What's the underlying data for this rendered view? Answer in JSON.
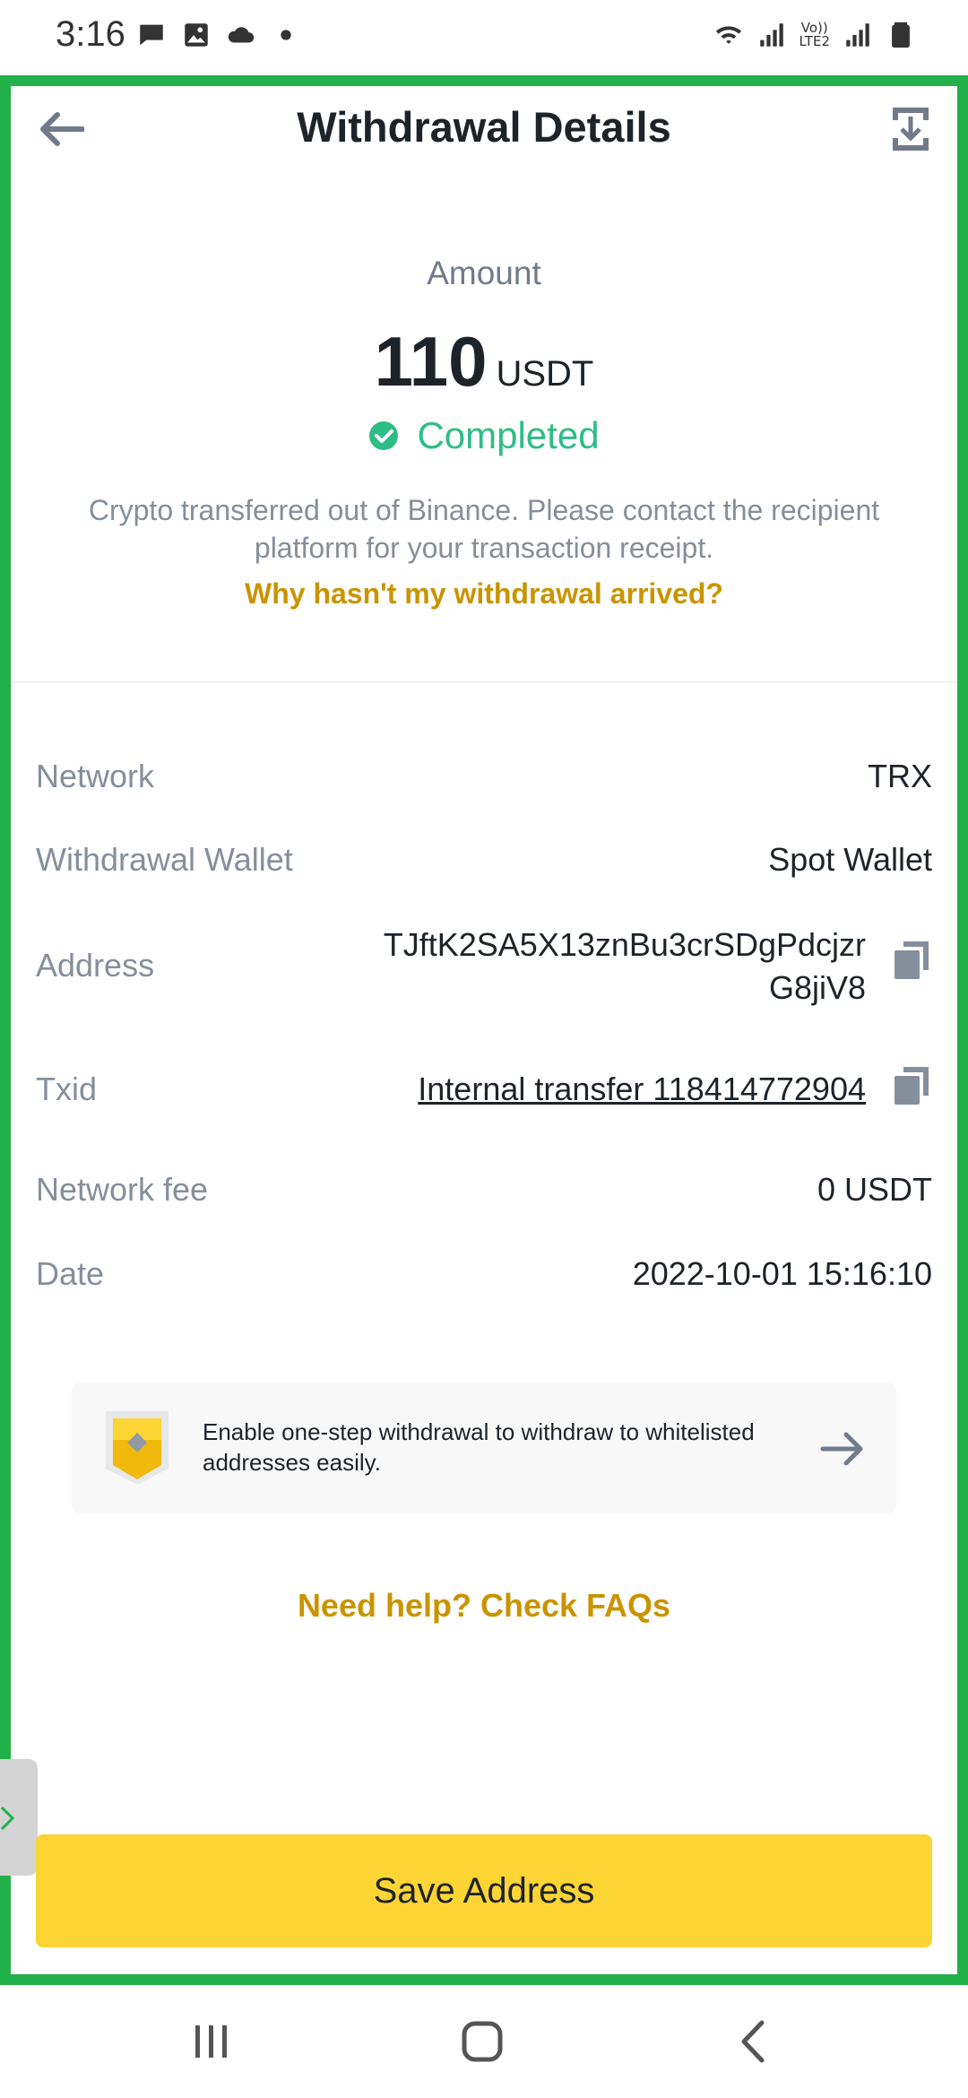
{
  "status_bar": {
    "time": "3:16",
    "icons": [
      "chat-icon",
      "gallery-icon",
      "cloud-icon",
      "dot-icon",
      "wifi-icon",
      "signal-icon",
      "volte-icon",
      "signal-icon",
      "battery-icon"
    ],
    "volte_text_1": "Vo))",
    "volte_text_2": "LTE2"
  },
  "header": {
    "title": "Withdrawal Details",
    "back_icon": "arrow-left-icon",
    "download_icon": "download-icon"
  },
  "summary": {
    "amount_label": "Amount",
    "amount": "110",
    "unit": "USDT",
    "status": "Completed",
    "description": "Crypto transferred out of Binance. Please contact the recipient platform for your transaction receipt.",
    "help_link": "Why hasn't my withdrawal arrived?"
  },
  "details": {
    "network": {
      "label": "Network",
      "value": "TRX"
    },
    "wallet": {
      "label": "Withdrawal Wallet",
      "value": "Spot Wallet"
    },
    "address": {
      "label": "Address",
      "value": "TJftK2SA5X13znBu3crSDgPdcjzrG8jiV8"
    },
    "txid": {
      "label": "Txid",
      "value": "Internal transfer 118414772904"
    },
    "fee": {
      "label": "Network fee",
      "value": "0 USDT"
    },
    "date": {
      "label": "Date",
      "value": "2022-10-01 15:16:10"
    }
  },
  "promo": {
    "text": "Enable one-step withdrawal to withdraw to whitelisted addresses easily."
  },
  "faq_link": "Need help? Check FAQs",
  "save_button": "Save Address",
  "colors": {
    "accent_yellow": "#fcd535",
    "link_gold": "#c99400",
    "success_green": "#2ebd85",
    "frame_green": "#22b04a"
  }
}
